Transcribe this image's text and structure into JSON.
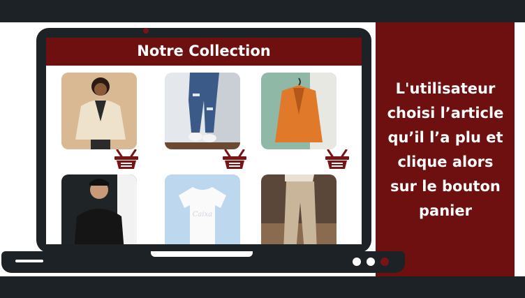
{
  "screen": {
    "title": "Notre Collection"
  },
  "caption": {
    "lines": [
      "L'utilisateur",
      "choisi l’article",
      "qu’il l’a plu et",
      "clique alors",
      "sur le bouton",
      "panier"
    ]
  },
  "products": [
    {
      "name": "beige-jacket",
      "bg": "#d8b894"
    },
    {
      "name": "ripped-jeans",
      "bg": "#dfe5ea"
    },
    {
      "name": "orange-blazer",
      "bg": "#8fb7a6"
    },
    {
      "name": "black-tshirt",
      "bg": "#1e2326"
    },
    {
      "name": "white-tshirt",
      "bg": "#bcd8ef"
    },
    {
      "name": "beige-trousers",
      "bg": "#5a4738"
    }
  ],
  "colors": {
    "accent": "#6e1010",
    "dark": "#1c2226",
    "basket": "#7a1414"
  }
}
